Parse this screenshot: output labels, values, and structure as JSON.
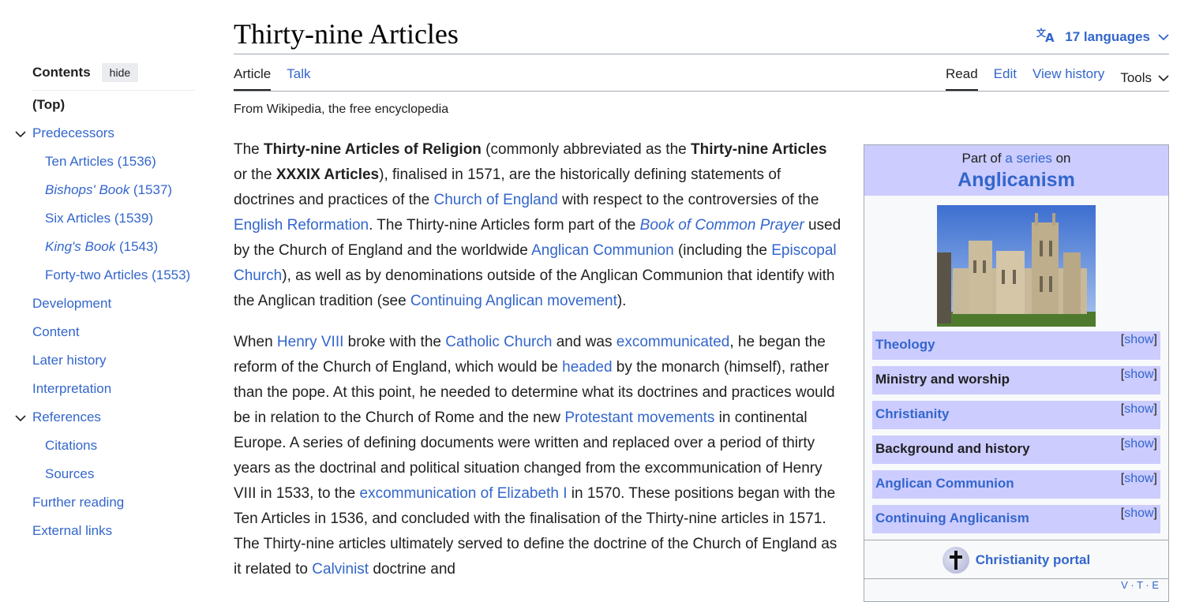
{
  "page": {
    "title": "Thirty-nine Articles",
    "languages_label": "17 languages",
    "tagline": "From Wikipedia, the free encyclopedia"
  },
  "tabs": {
    "article": "Article",
    "talk": "Talk",
    "read": "Read",
    "edit": "Edit",
    "view_history": "View history",
    "tools": "Tools"
  },
  "toc": {
    "title": "Contents",
    "hide": "hide",
    "items": [
      {
        "label": "(Top)"
      },
      {
        "label": "Predecessors"
      },
      {
        "label": "Ten Articles (1536)"
      },
      {
        "title": "Bishops' Book",
        "year": " (1537)"
      },
      {
        "label": "Six Articles (1539)"
      },
      {
        "title": "King's Book",
        "year": " (1543)"
      },
      {
        "label": "Forty-two Articles (1553)"
      },
      {
        "label": "Development"
      },
      {
        "label": "Content"
      },
      {
        "label": "Later history"
      },
      {
        "label": "Interpretation"
      },
      {
        "label": "References"
      },
      {
        "label": "Citations"
      },
      {
        "label": "Sources"
      },
      {
        "label": "Further reading"
      },
      {
        "label": "External links"
      }
    ]
  },
  "body": {
    "p1": [
      "The ",
      "Thirty-nine Articles of Religion",
      " (commonly abbreviated as the ",
      "Thirty-nine Articles",
      " or the ",
      "XXXIX Articles",
      "), finalised in 1571, are the historically defining statements of doctrines and practices of the ",
      "Church of England",
      " with respect to the controversies of the ",
      "English Reformation",
      ". The Thirty-nine Articles form part of the ",
      "Book of Common Prayer",
      " used by the Church of England and the worldwide ",
      "Anglican Communion",
      " (including the ",
      "Episcopal Church",
      "), as well as by denominations outside of the Anglican Communion that identify with the Anglican tradition (see ",
      "Continuing Anglican movement",
      ")."
    ],
    "p2": [
      "When ",
      "Henry VIII",
      " broke with the ",
      "Catholic Church",
      " and was ",
      "excommunicated",
      ", he began the reform of the Church of England, which would be ",
      "headed",
      " by the monarch (himself), rather than the pope. At this point, he needed to determine what its doctrines and practices would be in relation to the Church of Rome and the new ",
      "Protestant movements",
      " in continental Europe. A series of defining documents were written and replaced over a period of thirty years as the doctrinal and political situation changed from the excommunication of Henry VIII in 1533, to the ",
      "excommunication of Elizabeth I",
      " in 1570. These positions began with the Ten Articles in 1536, and concluded with the finalisation of the Thirty-nine articles in 1571. The Thirty-nine articles ultimately served to define the doctrine of the Church of England as it related to ",
      "Calvinist",
      " doctrine and"
    ]
  },
  "infobox": {
    "above_prefix": "Part of ",
    "above_link": "a series",
    "above_suffix": " on",
    "title": "Anglicanism",
    "rows": [
      {
        "label": "Theology",
        "show": "show"
      },
      {
        "label": "Ministry and worship",
        "show": "show"
      },
      {
        "label": "Christianity",
        "show": "show"
      },
      {
        "label": "Background and history",
        "show": "show"
      },
      {
        "label": "Anglican Communion",
        "show": "show"
      },
      {
        "label": "Continuing Anglicanism",
        "show": "show"
      }
    ],
    "portal": "Christianity portal",
    "vte": "V · T · E"
  },
  "colors": {
    "link": "#3366cc",
    "infobox_header": "#ccccff",
    "text": "#202122"
  }
}
